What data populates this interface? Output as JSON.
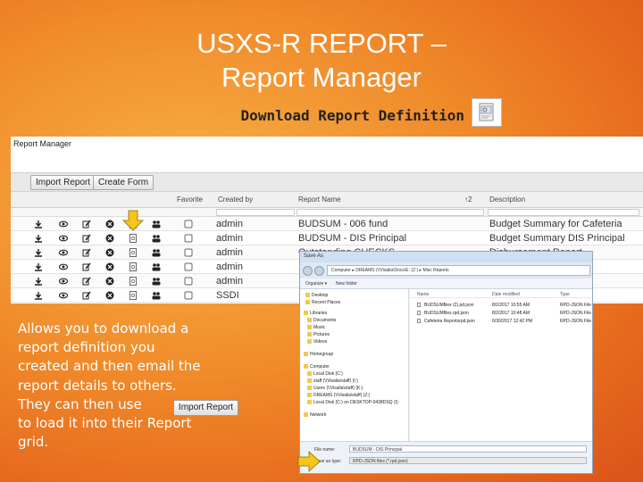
{
  "slide": {
    "title_line1": "USXS-R REPORT –",
    "title_line2": "Report Manager",
    "subtitle": "Download Report Definition",
    "body_lines": [
      "Allows you to download a",
      "report definition you",
      "created and then email the",
      "report details to others.",
      "They can then use",
      "to load it into their Report",
      "grid."
    ],
    "inline_button_label": "Import Report"
  },
  "report_manager": {
    "title": "Report Manager",
    "toolbar": {
      "import_label": "Import Report",
      "create_label": "Create Form"
    },
    "headers": {
      "favorite": "Favorite",
      "created_by": "Created by",
      "report_name": "Report Name",
      "name_sort": "↑2",
      "description": "Description"
    },
    "rows": [
      {
        "created_by": "admin",
        "report_name": "BUDSUM - 006 fund",
        "description": "Budget Summary for Cafeteria"
      },
      {
        "created_by": "admin",
        "report_name": "BUDSUM - DIS Principal",
        "description": "Budget Summary DIS Principal"
      },
      {
        "created_by": "admin",
        "report_name": "Outstanding CHECKS",
        "description": "Disbursement Report"
      },
      {
        "created_by": "admin",
        "report_name": "",
        "description": ""
      },
      {
        "created_by": "admin",
        "report_name": "",
        "description": ""
      },
      {
        "created_by": "SSDI",
        "report_name": "",
        "description": ""
      }
    ]
  },
  "save_dialog": {
    "title": "Save As",
    "address": "Computer ▸ DREAMS (\\\\Visalia\\Docs\\E: (Z:) ▸ Misc Reports",
    "search_placeholder": "Search Misc Reports",
    "organize": "Organize ▾",
    "new_folder": "New folder",
    "nav_items": [
      "Desktop",
      "Recent Places",
      "Libraries",
      "Documents",
      "Music",
      "Pictures",
      "Videos",
      "Homegroup",
      "Computer",
      "Local Disk (C:)",
      "staff (\\\\Visalia\\staff) (I:)",
      "Users (\\\\Visalia\\staff) (K:)",
      "DREAMS (\\\\Visalia\\staff) (Z:)",
      "Local Disk (C:) on DESKTOP-0438DSQ (I)",
      "Network"
    ],
    "list_headers": {
      "name": "Name",
      "date": "Date modified",
      "type": "Type"
    },
    "files": [
      {
        "name": "BUDSUMfiles (2).pd.json",
        "date": "8/2/2017 10:55 AM",
        "type": "RPD-JSON File"
      },
      {
        "name": "BUDSUMfiles.rpd.json",
        "date": "8/2/2017 10:48 AM",
        "type": "RPD-JSON File"
      },
      {
        "name": "Cafeteria Reportsrpd.json",
        "date": "6/30/2017 12:42 PM",
        "type": "RPD-JSON File"
      }
    ],
    "file_name_label": "File name:",
    "file_name": "BUDSUM - DIS Principal",
    "save_type_label": "Save as type:",
    "save_type": "RPD-JSON files (*.rpd.json)"
  },
  "colors": {
    "accent_orange": "#f08a2a",
    "arrow_yellow": "#f5c518",
    "white": "#ffffff"
  },
  "icons": [
    "download-icon",
    "view-icon",
    "edit-icon",
    "delete-icon",
    "download-definition-icon",
    "share-icon",
    "favorite-checkbox"
  ]
}
